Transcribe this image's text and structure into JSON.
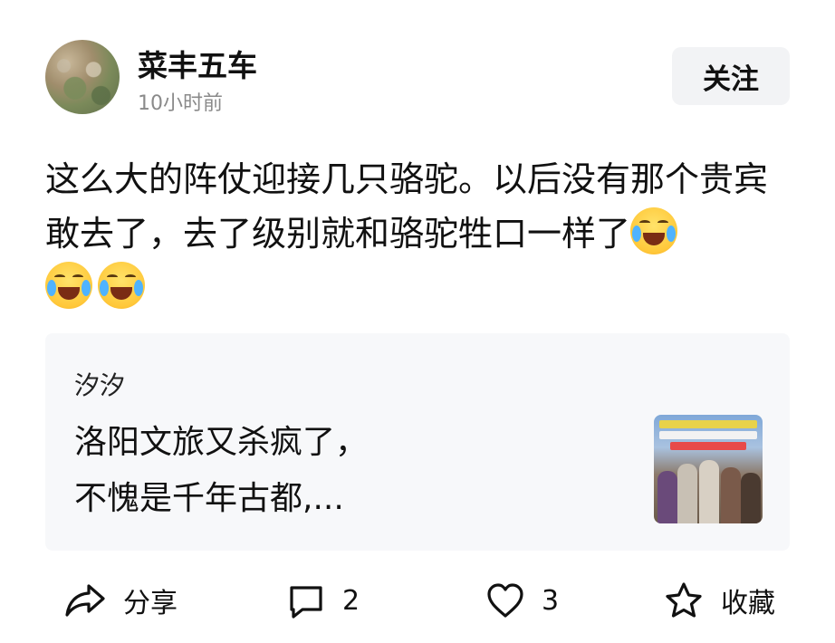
{
  "author": {
    "name": "菜丰五车",
    "time": "10小时前"
  },
  "follow_label": "关注",
  "post": {
    "text": "这么大的阵仗迎接几只骆驼。以后没有那个贵宾敢去了，去了级别就和骆驼牲口一样了",
    "emoji": "laugh-cry-emoji"
  },
  "quote": {
    "author": "汐汐",
    "line1": "洛阳文旅又杀疯了，",
    "line2": "不愧是千年古都,..."
  },
  "actions": {
    "share_label": "分享",
    "comment_count": "2",
    "like_count": "3",
    "favorite_label": "收藏"
  },
  "icons": {
    "share": "share-icon",
    "comment": "comment-icon",
    "like": "heart-icon",
    "favorite": "star-icon"
  }
}
